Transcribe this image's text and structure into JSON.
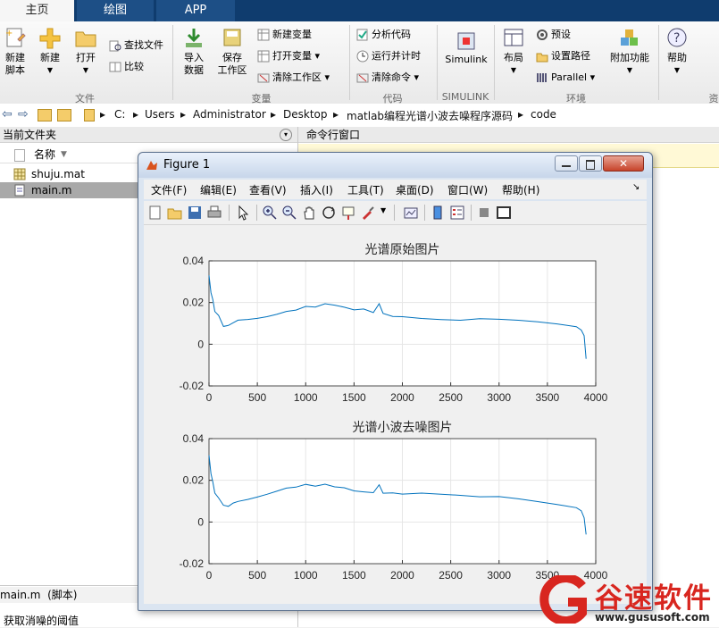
{
  "tabs": {
    "home": "主页",
    "plots": "绘图",
    "apps": "APP"
  },
  "ribbon": {
    "new_script": "新建\n脚本",
    "new": "新建",
    "open": "打开",
    "find_files": "查找文件",
    "compare": "比较",
    "import": "导入\n数据",
    "save_ws": "保存\n工作区",
    "new_var": "新建变量",
    "open_var": "打开变量",
    "clear_ws": "清除工作区",
    "analyze": "分析代码",
    "run_time": "运行并计时",
    "clear_cmd": "清除命令",
    "simulink": "Simulink",
    "layout": "布局",
    "prefs": "预设",
    "set_path": "设置路径",
    "parallel": "Parallel",
    "addons": "附加功能",
    "help": "帮助",
    "g_file": "文件",
    "g_var": "变量",
    "g_code": "代码",
    "g_simulink": "SIMULINK",
    "g_env": "环境",
    "g_res": "资"
  },
  "address": {
    "path": [
      "C:",
      "Users",
      "Administrator",
      "Desktop",
      "matlab编程光谱小波去噪程序源码",
      "code"
    ]
  },
  "left": {
    "header": "当前文件夹",
    "col_name": "名称",
    "files": [
      {
        "name": "shuju.mat",
        "type": "mat"
      },
      {
        "name": "main.m",
        "type": "m"
      }
    ],
    "detail": "main.m  (脚本)",
    "status": "获取消噪的阈值"
  },
  "cmd": {
    "header": "命令行窗口"
  },
  "figure": {
    "title": "Figure 1",
    "menu": [
      "文件(F)",
      "编辑(E)",
      "查看(V)",
      "插入(I)",
      "工具(T)",
      "桌面(D)",
      "窗口(W)",
      "帮助(H)"
    ],
    "plots": [
      {
        "title": "光谱原始图片"
      },
      {
        "title": "光谱小波去噪图片"
      }
    ]
  },
  "watermark": {
    "text": "谷速软件",
    "url": "www.gususoft.com"
  },
  "chart_data": [
    {
      "type": "line",
      "title": "光谱原始图片",
      "xlim": [
        0,
        4000
      ],
      "ylim": [
        -0.02,
        0.04
      ],
      "xticks": [
        0,
        500,
        1000,
        1500,
        2000,
        2500,
        3000,
        3500,
        4000
      ],
      "yticks": [
        -0.02,
        0,
        0.02,
        0.04
      ],
      "ytick_labels": [
        "-0.02",
        "0",
        "0.02",
        "0.04"
      ],
      "color": "#0072bd",
      "grid": true,
      "x": [
        0,
        20,
        40,
        60,
        100,
        150,
        200,
        250,
        300,
        400,
        500,
        600,
        700,
        800,
        900,
        1000,
        1100,
        1200,
        1300,
        1400,
        1500,
        1600,
        1700,
        1760,
        1800,
        1900,
        2000,
        2200,
        2400,
        2600,
        2800,
        3000,
        3200,
        3400,
        3600,
        3800,
        3850,
        3880,
        3900
      ],
      "y": [
        0.033,
        0.024,
        0.02,
        0.014,
        0.012,
        0.007,
        0.008,
        0.01,
        0.012,
        0.013,
        0.014,
        0.015,
        0.016,
        0.017,
        0.017,
        0.018,
        0.017,
        0.018,
        0.017,
        0.016,
        0.015,
        0.016,
        0.015,
        0.02,
        0.016,
        0.015,
        0.015,
        0.014,
        0.013,
        0.012,
        0.012,
        0.011,
        0.01,
        0.009,
        0.008,
        0.007,
        0.006,
        0.004,
        -0.007
      ]
    },
    {
      "type": "line",
      "title": "光谱小波去噪图片",
      "xlim": [
        0,
        4000
      ],
      "ylim": [
        -0.02,
        0.04
      ],
      "xticks": [
        0,
        500,
        1000,
        1500,
        2000,
        2500,
        3000,
        3500,
        4000
      ],
      "yticks": [
        -0.02,
        0,
        0.02,
        0.04
      ],
      "ytick_labels": [
        "-0.02",
        "0",
        "0.02",
        "0.04"
      ],
      "color": "#0072bd",
      "grid": true,
      "x": [
        0,
        20,
        40,
        60,
        100,
        150,
        200,
        250,
        300,
        400,
        500,
        600,
        700,
        800,
        900,
        1000,
        1100,
        1200,
        1300,
        1400,
        1500,
        1600,
        1700,
        1760,
        1800,
        1900,
        2000,
        2200,
        2400,
        2600,
        2800,
        3000,
        3200,
        3400,
        3600,
        3800,
        3850,
        3880,
        3900
      ],
      "y": [
        0.032,
        0.022,
        0.018,
        0.013,
        0.011,
        0.008,
        0.008,
        0.01,
        0.011,
        0.012,
        0.013,
        0.014,
        0.015,
        0.016,
        0.016,
        0.017,
        0.016,
        0.017,
        0.016,
        0.016,
        0.015,
        0.015,
        0.015,
        0.019,
        0.015,
        0.015,
        0.014,
        0.014,
        0.013,
        0.012,
        0.011,
        0.011,
        0.01,
        0.009,
        0.008,
        0.007,
        0.006,
        0.003,
        -0.006
      ]
    }
  ]
}
